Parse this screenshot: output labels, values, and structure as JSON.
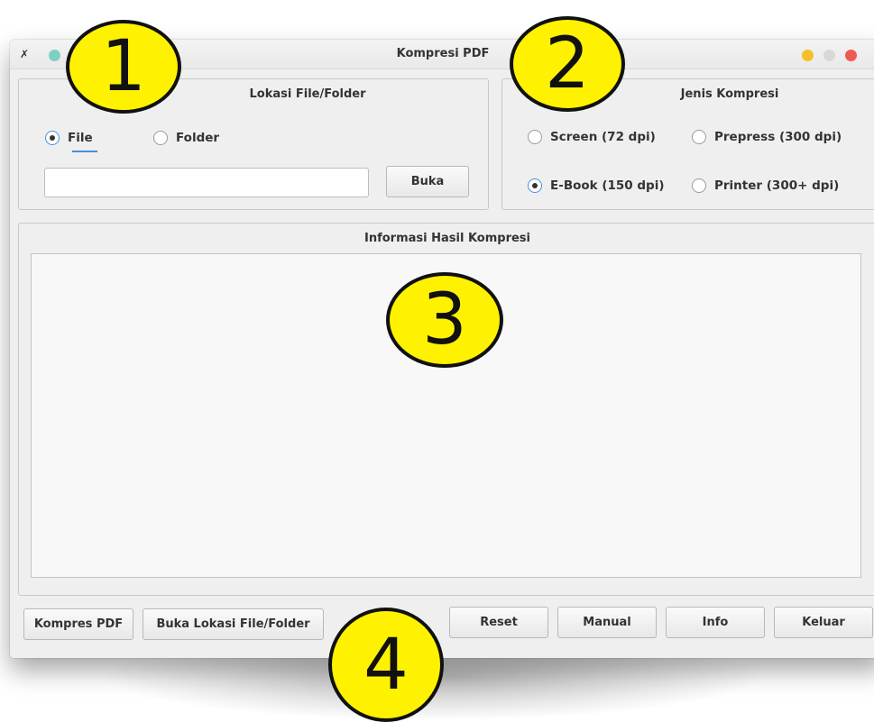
{
  "window": {
    "title": "Kompresi PDF",
    "app_icon": "✗"
  },
  "location_group": {
    "title": "Lokasi File/Folder",
    "options": [
      {
        "label": "File",
        "selected": true
      },
      {
        "label": "Folder",
        "selected": false
      }
    ],
    "path_value": "",
    "open_button": "Buka"
  },
  "compression_group": {
    "title": "Jenis Kompresi",
    "options": [
      {
        "label": "Screen (72 dpi)",
        "selected": false
      },
      {
        "label": "Prepress (300 dpi)",
        "selected": false
      },
      {
        "label": "E-Book (150 dpi)",
        "selected": true
      },
      {
        "label": "Printer (300+ dpi)",
        "selected": false
      }
    ]
  },
  "info_group": {
    "title": "Informasi Hasil Kompresi",
    "content": ""
  },
  "buttons": {
    "compress": "Kompres PDF",
    "open_location": "Buka Lokasi File/Folder",
    "reset": "Reset",
    "manual": "Manual",
    "info": "Info",
    "exit": "Keluar"
  },
  "annotations": [
    "1",
    "2",
    "3",
    "4"
  ],
  "colors": {
    "badge": "#fff200",
    "accent": "#4a90d9",
    "traffic_min": "#f5bf2a",
    "traffic_close": "#ee5a4f"
  }
}
